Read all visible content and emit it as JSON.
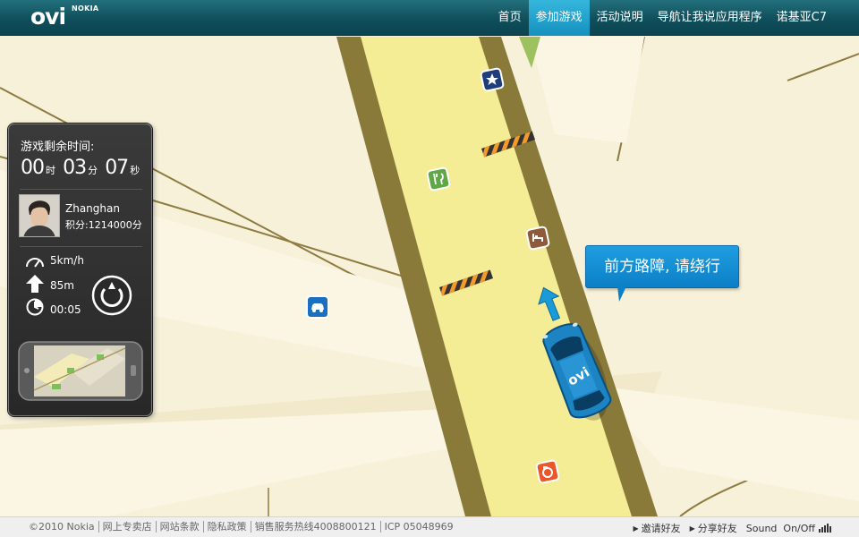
{
  "brand": {
    "logo": "ovi",
    "logo_sub": "NOKIA"
  },
  "nav": {
    "items": [
      {
        "label": "首页",
        "active": false
      },
      {
        "label": "参加游戏",
        "active": true
      },
      {
        "label": "活动说明",
        "active": false
      },
      {
        "label": "导航让我说应用程序",
        "active": false
      },
      {
        "label": "诺基亚C7",
        "active": false
      }
    ]
  },
  "panel": {
    "time_label": "游戏剩余时间:",
    "hours": "00",
    "hours_unit": "时",
    "minutes": "03",
    "minutes_unit": "分",
    "seconds": "07",
    "seconds_unit": "秒",
    "player_name": "Zhanghan",
    "score": "积分:1214000分",
    "speed": "5km/h",
    "distance": "85m",
    "eta": "00:05"
  },
  "message": "前方路障, 请绕行",
  "car_logo": "ovi",
  "icons": {
    "poi": [
      "star-icon",
      "restaurant-icon",
      "hotel-icon",
      "car-service-icon",
      "camera-icon"
    ]
  },
  "colors": {
    "topbar": "#0f4f5b",
    "nav_active": "#1f9ee0",
    "road": "#f5ec96",
    "road_edge": "#8a7a3a",
    "ground": "#f7f1da",
    "bubble": "#1a93d8",
    "car": "#1d84c4"
  },
  "footer": {
    "copyright": "©2010 Nokia",
    "links": [
      "网上专卖店",
      "网站条款",
      "隐私政策",
      "销售服务热线4008800121",
      "ICP 05048969"
    ],
    "invite": "邀请好友",
    "share": "分享好友",
    "sound": "Sound  On/Off"
  }
}
